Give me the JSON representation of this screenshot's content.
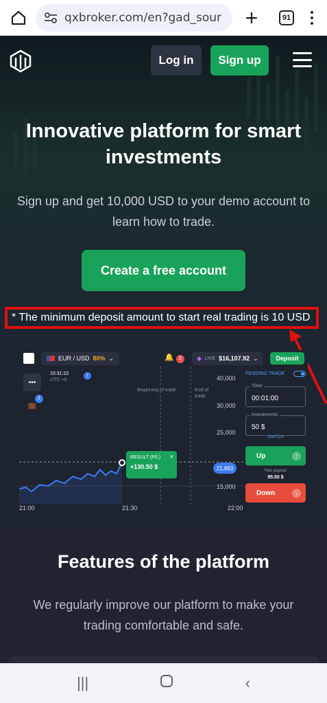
{
  "browser": {
    "url": "qxbroker.com/en?gad_sour",
    "tab_count": "91"
  },
  "nav": {
    "login": "Log in",
    "signup": "Sign up"
  },
  "hero": {
    "title": "Innovative platform for smart investments",
    "subtitle": "Sign up and get 10,000 USD to your demo account to learn how to trade.",
    "cta": "Create a free account",
    "notice": "* The minimum deposit amount to start real trading is 10 USD"
  },
  "platform": {
    "pair": "EUR / USD",
    "payout_pct": "80%",
    "notifications": "2",
    "live_label": "LIVE",
    "balance": "$16,107.92",
    "deposit": "Deposit",
    "time": "15:31:22",
    "tz": "UTC +8",
    "side_badge": "2",
    "begin_label": "Beginning of trade",
    "end_label": "End of trade",
    "y_ticks": [
      "40,000",
      "30,000",
      "25,000",
      "15,000"
    ],
    "x_ticks": [
      "21:00",
      "21:30",
      "22:00"
    ],
    "current_price": "21,893",
    "result_label": "RESULT (P/L)",
    "result_value": "+130.50 $",
    "pending_trade": "PENDING TRADE",
    "time_label": "Time:",
    "time_value": "00:01:00",
    "investment_label": "Investments:",
    "investment_value": "50 $",
    "switch": "SWITCH",
    "up": "Up",
    "payout_label": "Your payout:",
    "payout_value": "95.50 $",
    "down": "Down"
  },
  "features": {
    "title": "Features of the platform",
    "text": "We regularly improve our platform to make your trading comfortable and safe."
  },
  "colors": {
    "accent_green": "#19a35a",
    "notice_red": "#e01010",
    "down_red": "#e74c3c",
    "blue": "#3d7cf0"
  }
}
